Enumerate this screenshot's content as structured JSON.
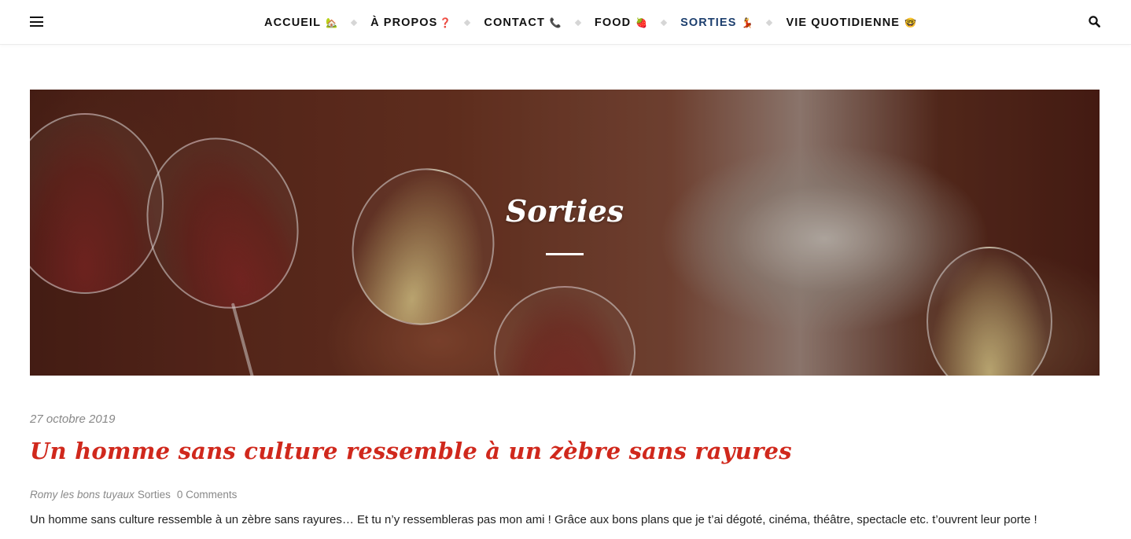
{
  "nav": {
    "items": [
      {
        "label": "ACCUEIL",
        "emoji": "🏡",
        "active": false
      },
      {
        "label": "À PROPOS",
        "emoji": "❓",
        "active": false
      },
      {
        "label": "CONTACT",
        "emoji": "📞",
        "active": false
      },
      {
        "label": "FOOD",
        "emoji": "🍓",
        "active": false
      },
      {
        "label": "SORTIES",
        "emoji": "💃",
        "active": true
      },
      {
        "label": "VIE QUOTIDIENNE",
        "emoji": "🤓",
        "active": false
      }
    ],
    "active_color": "#1d3f6e",
    "menu_icon": "hamburger-menu-icon",
    "search_icon": "search-icon"
  },
  "hero": {
    "title": "Sorties"
  },
  "post": {
    "date": "27 octobre 2019",
    "title": "Un homme sans culture ressemble à un zèbre sans rayures",
    "author": "Romy les bons tuyaux",
    "category": "Sorties",
    "comments": "0 Comments",
    "excerpt": "Un homme sans culture ressemble à un zèbre sans rayures… Et tu n’y ressembleras pas mon ami ! Grâce aux bons plans que je t’ai dégoté, cinéma, théâtre, spectacle etc. t’ouvrent leur porte !",
    "title_color": "#d0281c"
  }
}
